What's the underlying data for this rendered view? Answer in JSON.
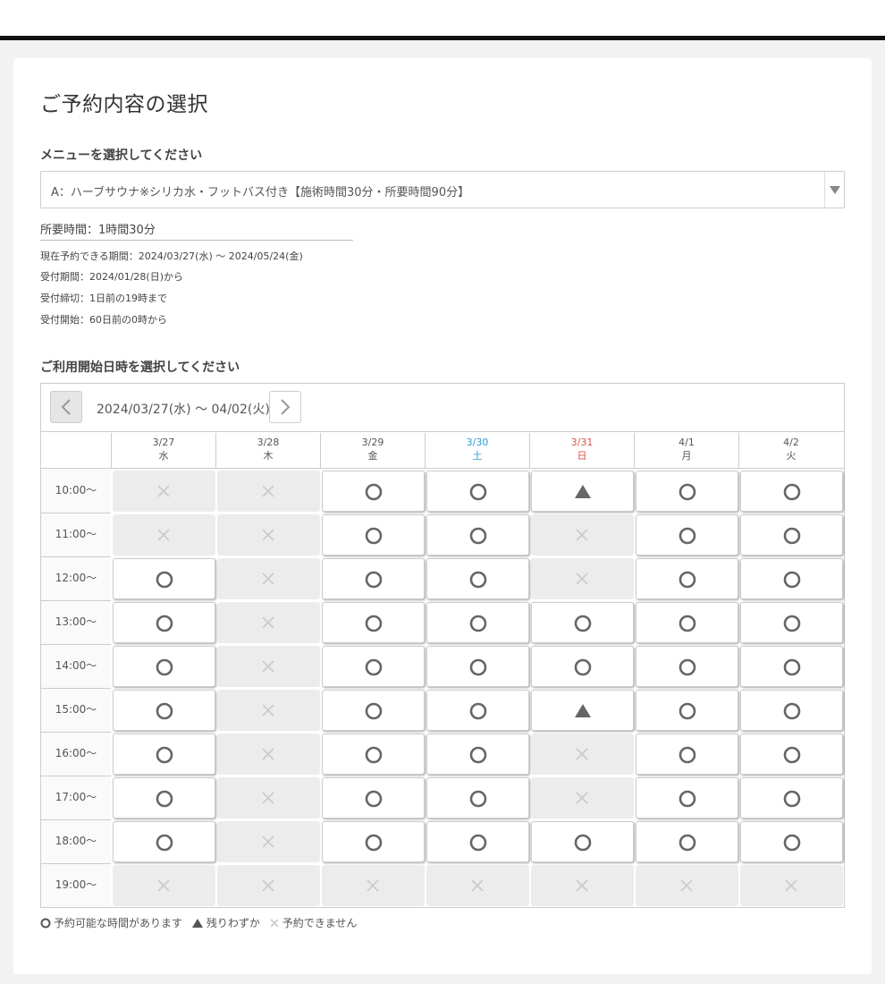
{
  "page": {
    "title": "ご予約内容の選択"
  },
  "menu": {
    "label": "メニューを選択してください",
    "selected": "A：ハーブサウナ※シリカ水・フットバス付き【施術時間30分・所要時間90分】"
  },
  "info": {
    "duration": "所要時間：1時間30分",
    "lines": [
      "現在予約できる期間：2024/03/27(水) 〜 2024/05/24(金)",
      "受付期間：2024/01/28(日)から",
      "受付締切：1日前の19時まで",
      "受付開始：60日前の0時から"
    ]
  },
  "calendar": {
    "label": "ご利用開始日時を選択してください",
    "range": "2024/03/27(水) 〜 04/02(火)",
    "days": [
      {
        "date": "3/27",
        "dow": "水",
        "type": "weekday"
      },
      {
        "date": "3/28",
        "dow": "木",
        "type": "weekday"
      },
      {
        "date": "3/29",
        "dow": "金",
        "type": "weekday"
      },
      {
        "date": "3/30",
        "dow": "土",
        "type": "sat"
      },
      {
        "date": "3/31",
        "dow": "日",
        "type": "sun"
      },
      {
        "date": "4/1",
        "dow": "月",
        "type": "weekday"
      },
      {
        "date": "4/2",
        "dow": "火",
        "type": "weekday"
      }
    ],
    "times": [
      "10:00〜",
      "11:00〜",
      "12:00〜",
      "13:00〜",
      "14:00〜",
      "15:00〜",
      "16:00〜",
      "17:00〜",
      "18:00〜",
      "19:00〜"
    ],
    "status": [
      [
        "x",
        "x",
        "o",
        "o",
        "t",
        "o",
        "o"
      ],
      [
        "x",
        "x",
        "o",
        "o",
        "x",
        "o",
        "o"
      ],
      [
        "o",
        "x",
        "o",
        "o",
        "x",
        "o",
        "o"
      ],
      [
        "o",
        "x",
        "o",
        "o",
        "o",
        "o",
        "o"
      ],
      [
        "o",
        "x",
        "o",
        "o",
        "o",
        "o",
        "o"
      ],
      [
        "o",
        "x",
        "o",
        "o",
        "t",
        "o",
        "o"
      ],
      [
        "o",
        "x",
        "o",
        "o",
        "x",
        "o",
        "o"
      ],
      [
        "o",
        "x",
        "o",
        "o",
        "x",
        "o",
        "o"
      ],
      [
        "o",
        "x",
        "o",
        "o",
        "o",
        "o",
        "o"
      ],
      [
        "x",
        "x",
        "x",
        "x",
        "x",
        "x",
        "x"
      ]
    ]
  },
  "legend": {
    "available": "予約可能な時間があります",
    "few": "残りわずか",
    "unavailable": "予約できません"
  },
  "colors": {
    "saturday": "#2a9bd6",
    "sunday": "#e0504a",
    "mark": "#666666",
    "cross": "#cccccc"
  },
  "icons": {
    "available": "circle-icon",
    "few": "triangle-icon",
    "unavailable": "cross-icon",
    "prev": "chevron-left-icon",
    "next": "chevron-right-icon",
    "dropdown": "caret-down-icon"
  }
}
